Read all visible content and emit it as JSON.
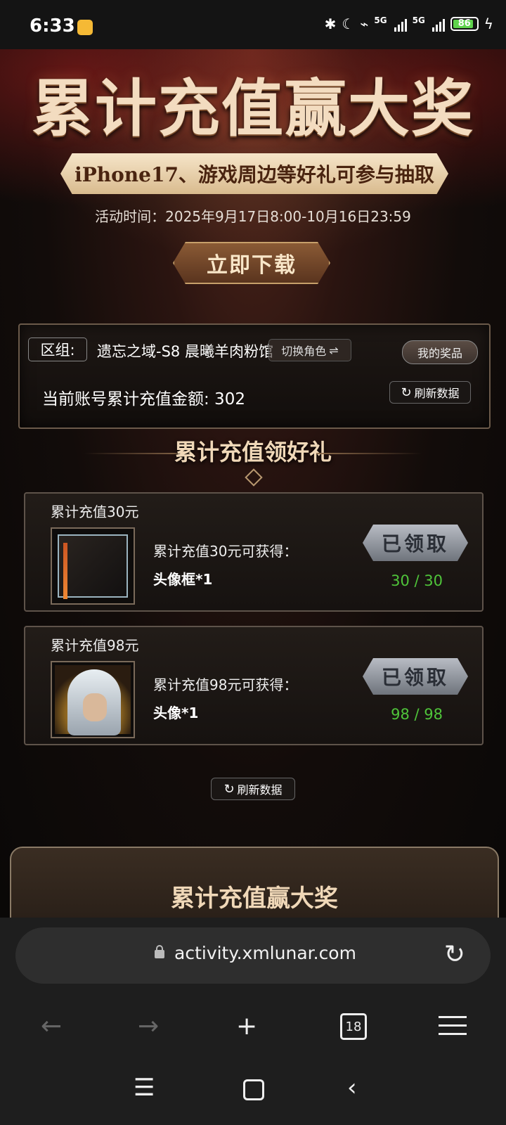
{
  "status_bar": {
    "time": "6:33",
    "network_1": "5G",
    "network_2": "5G",
    "battery": "86"
  },
  "hero": {
    "title": "累计充值赢大奖",
    "subtitle": "iPhone17、游戏周边等好礼可参与抽取",
    "activity_time": "活动时间：2025年9月17日8:00-10月16日23:59",
    "download_button": "立即下载"
  },
  "account_panel": {
    "zone_label": "区组:",
    "zone_value": "遗忘之域-S8 晨曦羊肉粉馆",
    "switch_role": "切换角色",
    "my_prizes": "我的奖品",
    "total_recharge": "当前账号累计充值金额: 302",
    "refresh": "刷新数据"
  },
  "section": {
    "title": "累计充值领好礼"
  },
  "rewards": [
    {
      "title": "累计充值30元",
      "description": "累计充值30元可获得：",
      "item": "头像框*1",
      "status": "已领取",
      "progress": "30 / 30"
    },
    {
      "title": "累计充值98元",
      "description": "累计充值98元可获得：",
      "item": "头像*1",
      "status": "已领取",
      "progress": "98 / 98"
    }
  ],
  "refresh_bottom": "刷新数据",
  "bottom_section": {
    "title": "累计充值赢大奖"
  },
  "browser": {
    "url": "activity.xmlunar.com",
    "tab_count": "18"
  },
  "colors": {
    "accent_gold": "#f0d8b8",
    "progress_green": "#4fc43a",
    "battery_green": "#5fd34c"
  }
}
